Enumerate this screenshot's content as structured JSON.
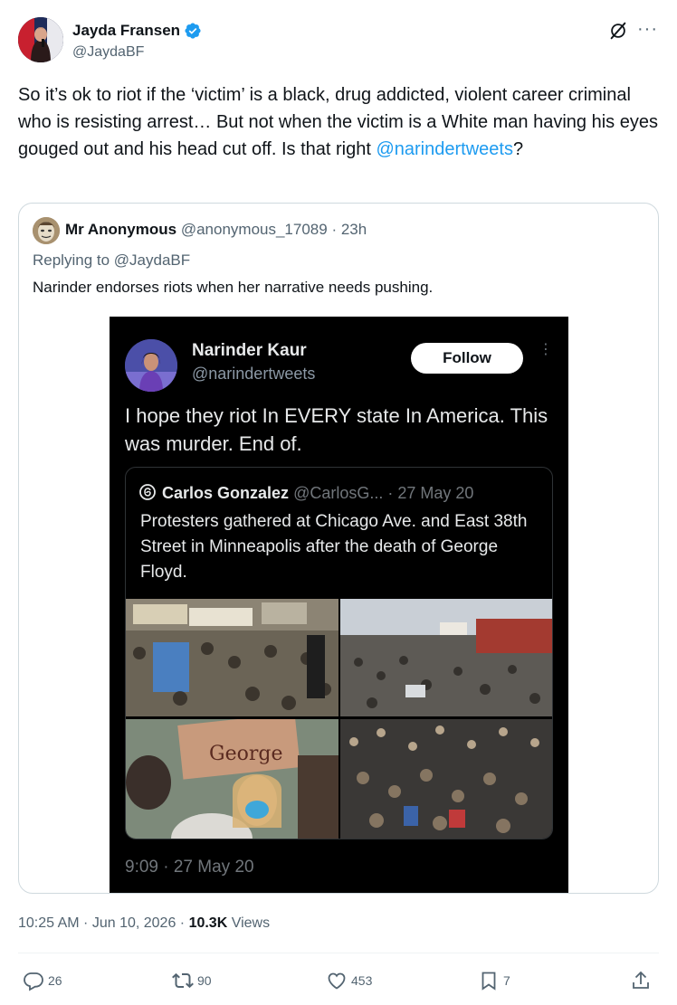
{
  "author": {
    "name": "Jayda Fransen",
    "handle": "@JaydaBF"
  },
  "header_icons": {
    "grok": "grok-slash-icon",
    "more": "more-dots-icon",
    "more_glyph": "···"
  },
  "tweet": {
    "text": "So it’s ok to riot if the ‘victim’ is a black, drug addicted, violent career criminal who is resisting arrest… But not when the victim is a White man having his eyes gouged out and his head cut off. Is that right ",
    "mention": "@narindertweets",
    "text_end": "?"
  },
  "quote": {
    "name": "Mr Anonymous",
    "handle": "@anonymous_17089",
    "time": "· 23h",
    "replying_to": "Replying to @JaydaBF",
    "text": "Narinder endorses riots when her narrative needs pushing.",
    "embed": {
      "name": "Narinder Kaur",
      "handle": "@narindertweets",
      "follow_label": "Follow",
      "dots": "⋮",
      "text": "I hope they riot In EVERY state In America. This was murder. End of.",
      "inner_quote": {
        "name": "Carlos Gonzalez",
        "handle": "@CarlosG...",
        "date": "· 27 May 20",
        "text": "Protesters gathered at Chicago Ave. and East 38th Street in Minneapolis after the death of George Floyd.",
        "sign_text": "George"
      },
      "time": "9:09 · 27 May 20"
    }
  },
  "meta": {
    "time": "10:25 AM · Jun 10, 2026 · ",
    "views_count": "10.3K",
    "views_label": " Views"
  },
  "actions": {
    "replies": "26",
    "reposts": "90",
    "likes": "453",
    "bookmarks": "7"
  },
  "colors": {
    "accent": "#1d9bf0",
    "secondary_text": "#536471",
    "border": "#cfd9de"
  }
}
